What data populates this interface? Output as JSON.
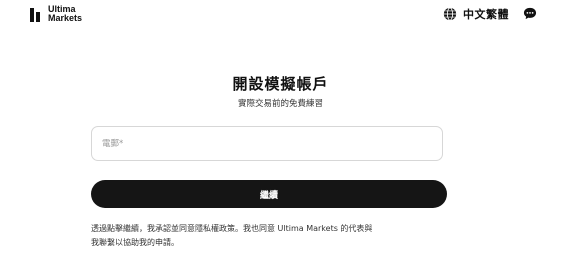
{
  "header": {
    "logo_line1": "Ultima",
    "logo_line2": "Markets",
    "language_label": "中文繁體",
    "globe_icon": "globe-icon",
    "chat_icon": "chat-bubble-icon"
  },
  "main": {
    "title": "開設模擬帳戶",
    "subtitle": "實際交易前的免費練習",
    "email_placeholder": "電郵*",
    "email_value": "",
    "continue_label": "繼續",
    "disclaimer_line1": "透過點擊繼續，我承認並同意隱私權政策。我也同意 Ultima Markets 的代表與",
    "disclaimer_line2": "我聯繫以協助我的申請。"
  },
  "colors": {
    "button_bg": "#151515",
    "button_text": "#ffffff",
    "field_border": "#d7d7d7"
  }
}
